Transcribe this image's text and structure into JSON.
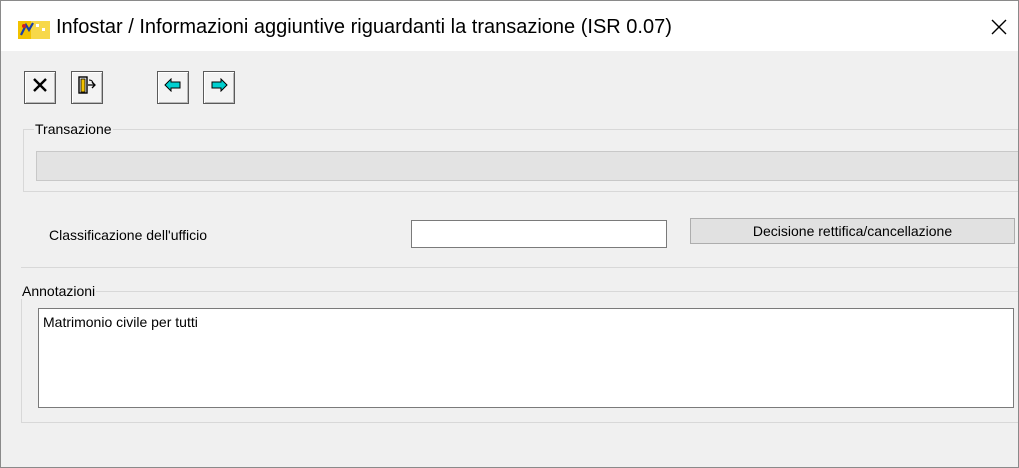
{
  "window": {
    "title": "Infostar / Informazioni aggiuntive riguardanti la transazione (ISR 0.07)"
  },
  "icons": {
    "app": "infostar-app-icon",
    "close": "close-icon",
    "cancel": "x-icon",
    "exit": "exit-door-icon",
    "prev": "arrow-left-icon",
    "next": "arrow-right-icon"
  },
  "colors": {
    "arrow": "#00d0d0",
    "icon_yellow": "#f2c200"
  },
  "transazione": {
    "legend": "Transazione",
    "value": ""
  },
  "classificazione": {
    "label": "Classificazione dell'ufficio",
    "value": ""
  },
  "decisione_button": "Decisione rettifica/cancellazione",
  "annotazioni": {
    "legend": "Annotazioni",
    "text": "Matrimonio civile per tutti"
  }
}
